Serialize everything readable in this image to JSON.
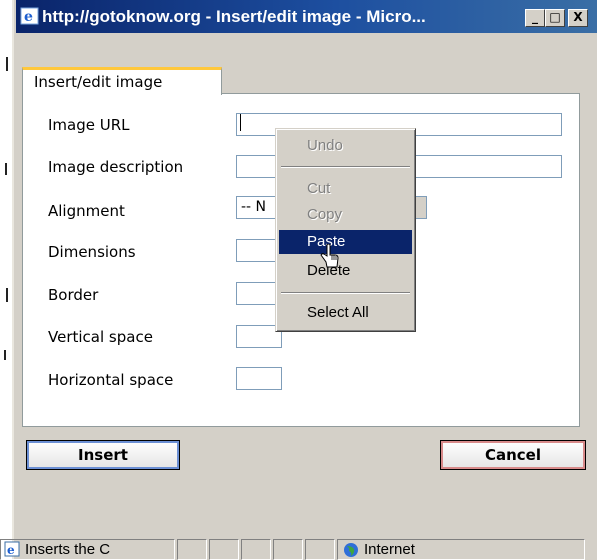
{
  "window": {
    "title": "http://gotoknow.org - Insert/edit image - Micro...",
    "buttons": [
      "_",
      "□",
      "X"
    ]
  },
  "dialog": {
    "tab_label": "Insert/edit image",
    "fields": {
      "image_url": {
        "label": "Image URL",
        "value": ""
      },
      "image_description": {
        "label": "Image description",
        "value": ""
      },
      "alignment": {
        "label": "Alignment",
        "selected": "-- N"
      },
      "dimensions": {
        "label": "Dimensions"
      },
      "border": {
        "label": "Border"
      },
      "vertical_space": {
        "label": "Vertical space"
      },
      "horizontal_space": {
        "label": "Horizontal space"
      }
    },
    "insert_label": "Insert",
    "cancel_label": "Cancel"
  },
  "context_menu": {
    "items": {
      "undo": {
        "label": "Undo",
        "enabled": false
      },
      "cut": {
        "label": "Cut",
        "enabled": false
      },
      "copy": {
        "label": "Copy",
        "enabled": false
      },
      "paste": {
        "label": "Paste",
        "enabled": true,
        "highlighted": true
      },
      "delete": {
        "label": "Delete",
        "enabled": true
      },
      "select_all": {
        "label": "Select All",
        "enabled": true
      }
    }
  },
  "status_bar": {
    "text": "Inserts the C",
    "zone": "Internet"
  },
  "colors": {
    "titlebar": "#0a246a",
    "highlight": "#0a246a",
    "tab_accent": "#ffc83c",
    "face": "#d4d0c8"
  }
}
